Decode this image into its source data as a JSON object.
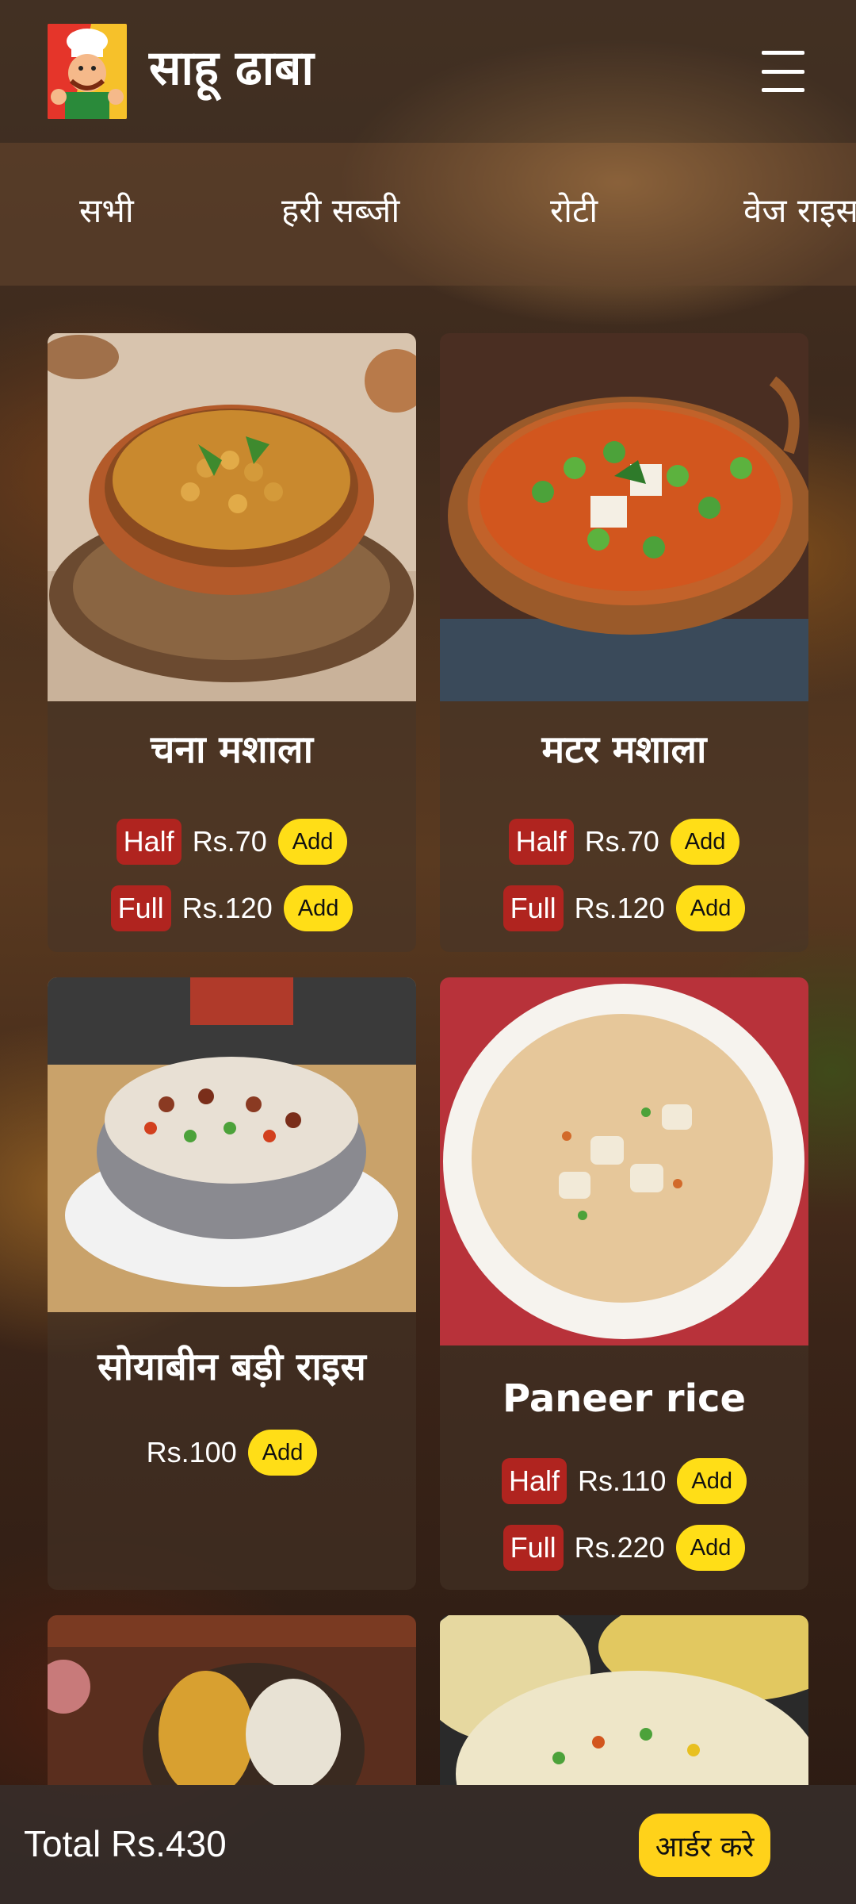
{
  "header": {
    "brand": "साहू ढाबा",
    "logo_icon": "chef-mascot-icon",
    "menu_icon": "hamburger-menu-icon"
  },
  "categories": [
    "सभी",
    "हरी सब्जी",
    "रोटी",
    "वेज राइस"
  ],
  "dishes": [
    {
      "name": "चना मशाला",
      "options": [
        {
          "tag": "Half",
          "price": "Rs.70",
          "add": "Add"
        },
        {
          "tag": "Full",
          "price": "Rs.120",
          "add": "Add"
        }
      ]
    },
    {
      "name": "मटर मशाला",
      "options": [
        {
          "tag": "Half",
          "price": "Rs.70",
          "add": "Add"
        },
        {
          "tag": "Full",
          "price": "Rs.120",
          "add": "Add"
        }
      ]
    },
    {
      "name": "सोयाबीन बड़ी राइस",
      "options": [
        {
          "price": "Rs.100",
          "add": "Add"
        }
      ]
    },
    {
      "name": "Paneer rice",
      "options": [
        {
          "tag": "Half",
          "price": "Rs.110",
          "add": "Add"
        },
        {
          "tag": "Full",
          "price": "Rs.220",
          "add": "Add"
        }
      ]
    }
  ],
  "cart": {
    "total": "Total Rs.430",
    "order_button": "आर्डर करे"
  },
  "colors": {
    "tag_bg": "#b0241f",
    "add_bg": "#ffde17",
    "order_bg": "#ffd21a"
  }
}
